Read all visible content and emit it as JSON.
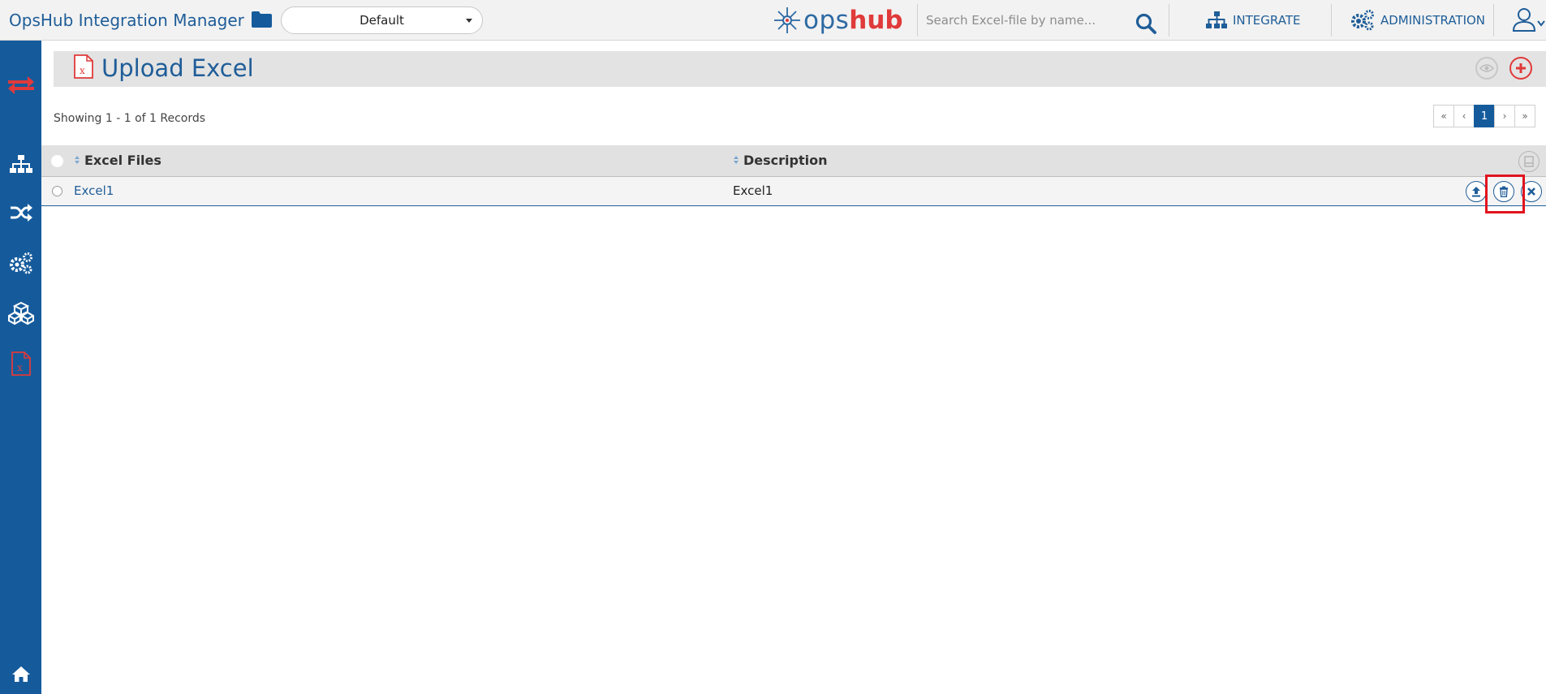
{
  "header": {
    "app_title": "OpsHub Integration Manager",
    "project_selected": "Default",
    "brand_part1": "ops",
    "brand_part2": "hub",
    "search_placeholder": "Search Excel-file by name...",
    "nav": [
      {
        "label": "INTEGRATE",
        "icon": "sitemap-icon"
      },
      {
        "label": "ADMINISTRATION",
        "icon": "gears-icon"
      }
    ],
    "user_icon": "user-icon"
  },
  "sidebar": {
    "items": [
      {
        "name": "sync-icon",
        "active": false
      },
      {
        "name": "sitemap-icon",
        "active": false
      },
      {
        "name": "shuffle-icon",
        "active": false
      },
      {
        "name": "gears-icon",
        "active": false
      },
      {
        "name": "cubes-icon",
        "active": false
      },
      {
        "name": "excel-file-icon",
        "active": true
      },
      {
        "name": "home-icon",
        "active": false
      }
    ]
  },
  "page": {
    "title": "Upload Excel",
    "records_text": "Showing 1 - 1 of 1 Records",
    "pager": {
      "first": "«",
      "prev": "‹",
      "current": "1",
      "next": "›",
      "last": "»"
    }
  },
  "table": {
    "columns": [
      "Excel Files",
      "Description"
    ],
    "rows": [
      {
        "name": "Excel1",
        "description": "Excel1"
      }
    ]
  },
  "colors": {
    "primary": "#1f5d98",
    "sidebar": "#155b9c",
    "accent_red": "#e03a3a",
    "highlight": "#e0141e"
  }
}
